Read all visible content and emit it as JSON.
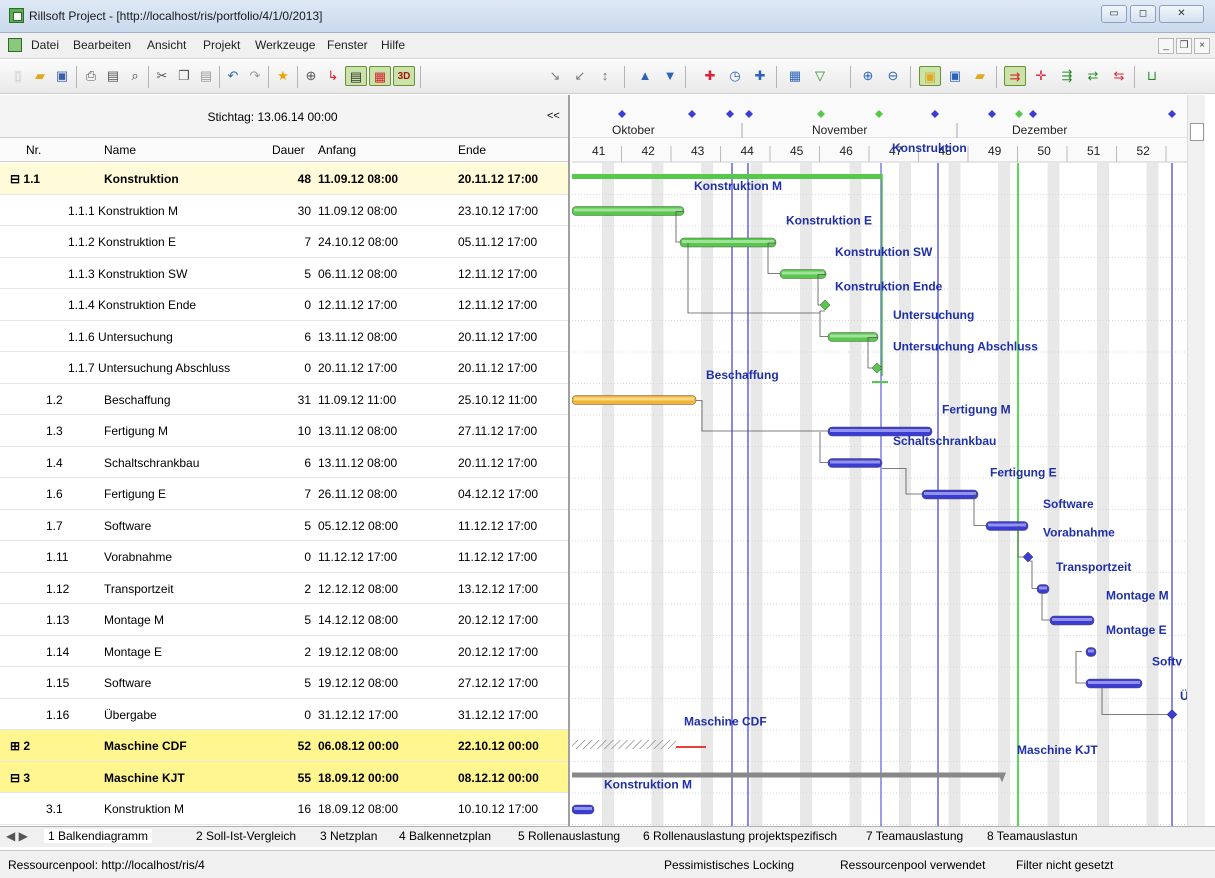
{
  "window": {
    "title": "Rillsoft Project - [http://localhost/ris/portfolio/4/1/0/2013]",
    "min": "▭",
    "max": "◻",
    "close": "✕"
  },
  "menu": [
    "Datei",
    "Bearbeiten",
    "Ansicht",
    "Projekt",
    "Werkzeuge",
    "Fenster",
    "Hilfe"
  ],
  "mdi": {
    "min": "_",
    "restore": "❐",
    "close": "×"
  },
  "toolbar": {
    "icons": [
      "new-doc",
      "open-folder",
      "save",
      "print",
      "print-preview",
      "find",
      "cut",
      "copy",
      "paste",
      "undo",
      "redo",
      "star",
      "link",
      "arrow-red",
      "gantt-view",
      "gantt-resource-view",
      "3d-view",
      "indent",
      "outdent",
      "insert",
      "up",
      "down",
      "add-task",
      "add-milestone",
      "add-resource",
      "calendar",
      "filter",
      "zoom-in",
      "zoom-out",
      "layout",
      "window",
      "folder-open",
      "critical-path",
      "arrows",
      "connect",
      "split",
      "sync",
      "fit"
    ],
    "label_3d": "3D"
  },
  "grid": {
    "stichtag": "Stichtag: 13.06.14 00:00",
    "collapse": "<<",
    "headers": {
      "nr": "Nr.",
      "name": "Name",
      "dauer": "Dauer",
      "anfang": "Anfang",
      "ende": "Ende"
    },
    "rows": [
      {
        "nr": "⊟ 1.1",
        "name": "Konstruktion",
        "dauer": "48",
        "anfang": "11.09.12 08:00",
        "ende": "20.11.12 17:00"
      },
      {
        "nr": "1.1.1 Konstruktion M",
        "name": "",
        "dauer": "30",
        "anfang": "11.09.12 08:00",
        "ende": "23.10.12 17:00"
      },
      {
        "nr": "1.1.2 Konstruktion E",
        "name": "",
        "dauer": "7",
        "anfang": "24.10.12 08:00",
        "ende": "05.11.12 17:00"
      },
      {
        "nr": "1.1.3 Konstruktion SW",
        "name": "",
        "dauer": "5",
        "anfang": "06.11.12 08:00",
        "ende": "12.11.12 17:00"
      },
      {
        "nr": "1.1.4 Konstruktion Ende",
        "name": "",
        "dauer": "0",
        "anfang": "12.11.12 17:00",
        "ende": "12.11.12 17:00"
      },
      {
        "nr": "1.1.6 Untersuchung",
        "name": "",
        "dauer": "6",
        "anfang": "13.11.12 08:00",
        "ende": "20.11.12 17:00"
      },
      {
        "nr": "1.1.7 Untersuchung Abschluss",
        "name": "",
        "dauer": "0",
        "anfang": "20.11.12 17:00",
        "ende": "20.11.12 17:00"
      },
      {
        "nr": "1.2",
        "name": "Beschaffung",
        "dauer": "31",
        "anfang": "11.09.12 11:00",
        "ende": "25.10.12 11:00"
      },
      {
        "nr": "1.3",
        "name": "Fertigung M",
        "dauer": "10",
        "anfang": "13.11.12 08:00",
        "ende": "27.11.12 17:00"
      },
      {
        "nr": "1.4",
        "name": "Schaltschrankbau",
        "dauer": "6",
        "anfang": "13.11.12 08:00",
        "ende": "20.11.12 17:00"
      },
      {
        "nr": "1.6",
        "name": "Fertigung E",
        "dauer": "7",
        "anfang": "26.11.12 08:00",
        "ende": "04.12.12 17:00"
      },
      {
        "nr": "1.7",
        "name": "Software",
        "dauer": "5",
        "anfang": "05.12.12 08:00",
        "ende": "11.12.12 17:00"
      },
      {
        "nr": "1.11",
        "name": "Vorabnahme",
        "dauer": "0",
        "anfang": "11.12.12 17:00",
        "ende": "11.12.12 17:00"
      },
      {
        "nr": "1.12",
        "name": "Transportzeit",
        "dauer": "2",
        "anfang": "12.12.12 08:00",
        "ende": "13.12.12 17:00"
      },
      {
        "nr": "1.13",
        "name": "Montage M",
        "dauer": "5",
        "anfang": "14.12.12 08:00",
        "ende": "20.12.12 17:00"
      },
      {
        "nr": "1.14",
        "name": "Montage E",
        "dauer": "2",
        "anfang": "19.12.12 08:00",
        "ende": "20.12.12 17:00"
      },
      {
        "nr": "1.15",
        "name": "Software",
        "dauer": "5",
        "anfang": "19.12.12 08:00",
        "ende": "27.12.12 17:00"
      },
      {
        "nr": "1.16",
        "name": "Übergabe",
        "dauer": "0",
        "anfang": "31.12.12 17:00",
        "ende": "31.12.12 17:00"
      },
      {
        "nr": "⊞ 2",
        "name": "Maschine CDF",
        "dauer": "52",
        "anfang": "06.08.12 00:00",
        "ende": "22.10.12 00:00"
      },
      {
        "nr": "⊟ 3",
        "name": "Maschine KJT",
        "dauer": "55",
        "anfang": "18.09.12 00:00",
        "ende": "08.12.12 00:00"
      },
      {
        "nr": "3.1",
        "name": "Konstruktion M",
        "dauer": "16",
        "anfang": "18.09.12 08:00",
        "ende": "10.10.12 17:00"
      }
    ]
  },
  "gantt": {
    "months": [
      "Oktober",
      "November",
      "Dezember"
    ],
    "weeks": [
      "41",
      "42",
      "43",
      "44",
      "45",
      "46",
      "47",
      "48",
      "49",
      "50",
      "51",
      "52"
    ],
    "bar_labels": [
      "Konstruktion",
      "Konstruktion M",
      "Konstruktion E",
      "Konstruktion SW",
      "Konstruktion Ende",
      "Untersuchung",
      "Untersuchung Abschluss",
      "Beschaffung",
      "Fertigung M",
      "Schaltschrankbau",
      "Fertigung E",
      "Software",
      "Vorabnahme",
      "Transportzeit",
      "Montage M",
      "Montage E",
      "Softv",
      "Ü",
      "Maschine CDF",
      "Maschine KJT",
      "Konstruktion M"
    ],
    "colors": {
      "green": "#57c94a",
      "orange": "#f2b634",
      "blue": "#3b3bd6",
      "label": "#1f2fa8",
      "today_line": "#22cc22"
    }
  },
  "tabs": [
    "1 Balkendiagramm",
    "2 Soll-Ist-Vergleich",
    "3 Netzplan",
    "4 Balkennetzplan",
    "5 Rollenauslastung",
    "6 Rollenauslastung projektspezifisch",
    "7 Teamauslastung",
    "8 Teamauslastun"
  ],
  "status": {
    "pool": "Ressourcenpool: http://localhost/ris/4",
    "locking": "Pessimistisches Locking",
    "used": "Ressourcenpool verwendet",
    "filter": "Filter nicht gesetzt"
  }
}
